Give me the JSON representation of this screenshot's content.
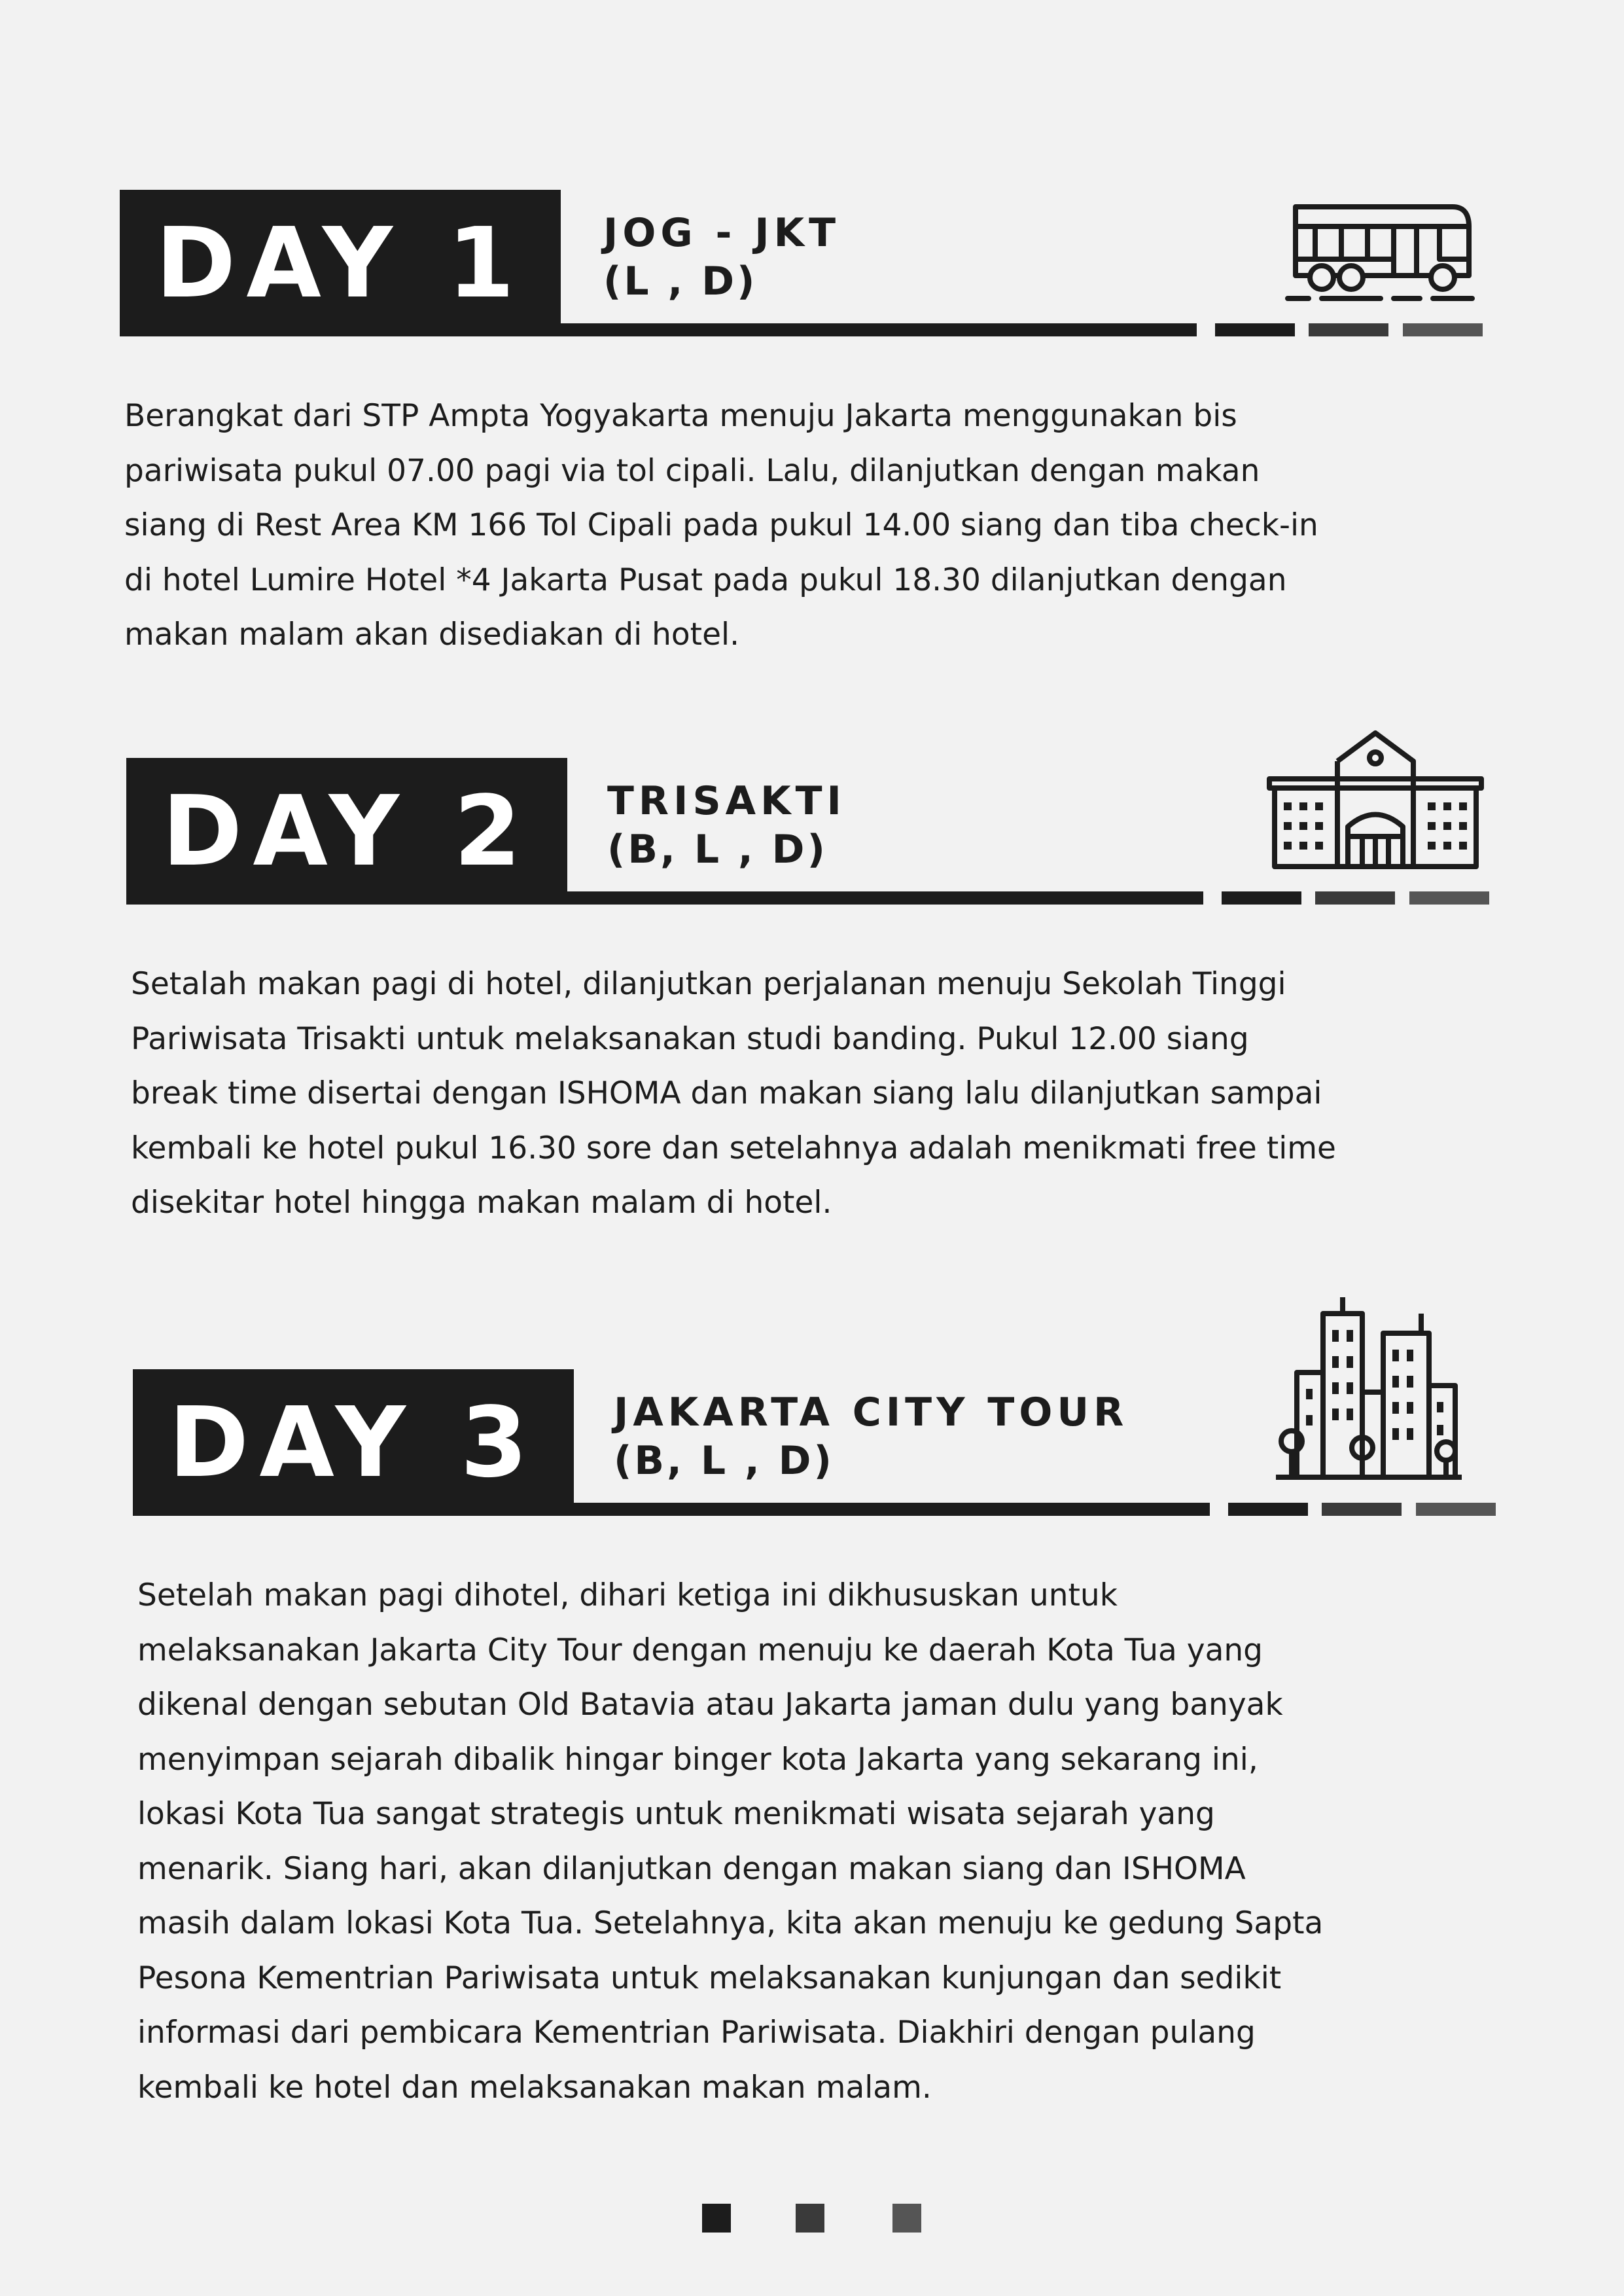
{
  "colors": {
    "ink": "#1c1c1c",
    "segment_dark": "#1c1c1c",
    "segment_mid": "#3a3a3a",
    "segment_light": "#555555",
    "background": "#f2f2f2"
  },
  "days": [
    {
      "label": "DAY 1",
      "title": "JOG - JKT",
      "meals": "(L , D)",
      "icon": "bus-icon",
      "body": [
        "Berangkat dari STP Ampta Yogyakarta menuju Jakarta menggunakan bis",
        "pariwisata pukul 07.00 pagi via tol cipali. Lalu, dilanjutkan dengan makan",
        "siang di Rest Area KM 166 Tol Cipali pada pukul 14.00 siang dan tiba check-in",
        "di hotel Lumire Hotel *4 Jakarta Pusat pada pukul 18.30 dilanjutkan dengan",
        "makan malam akan disediakan di hotel."
      ]
    },
    {
      "label": "DAY 2",
      "title": "TRISAKTI",
      "meals": "(B, L , D)",
      "icon": "school-building-icon",
      "body": [
        "Setalah makan pagi di hotel, dilanjutkan perjalanan menuju Sekolah Tinggi",
        "Pariwisata Trisakti untuk melaksanakan studi banding. Pukul 12.00 siang",
        "break time disertai dengan ISHOMA dan makan siang lalu dilanjutkan sampai",
        "kembali ke hotel pukul 16.30 sore dan setelahnya adalah menikmati free time",
        "disekitar hotel hingga makan malam di hotel."
      ]
    },
    {
      "label": "DAY 3",
      "title": "JAKARTA CITY TOUR",
      "meals": "(B, L , D)",
      "icon": "city-skyline-icon",
      "body": [
        "Setelah makan pagi dihotel, dihari ketiga ini dikhususkan untuk",
        "melaksanakan Jakarta City Tour dengan menuju ke daerah Kota Tua yang",
        "dikenal dengan sebutan Old Batavia atau Jakarta jaman dulu yang banyak",
        "menyimpan sejarah dibalik hingar binger kota Jakarta yang sekarang ini,",
        "lokasi Kota Tua sangat strategis untuk menikmati wisata sejarah yang",
        "menarik. Siang hari, akan dilanjutkan dengan makan siang dan ISHOMA",
        "masih dalam lokasi Kota Tua. Setelahnya, kita akan menuju ke gedung Sapta",
        "Pesona Kementrian Pariwisata untuk melaksanakan kunjungan dan sedikit",
        "informasi dari pembicara Kementrian Pariwisata. Diakhiri dengan pulang",
        "kembali ke hotel dan melaksanakan makan malam."
      ]
    }
  ],
  "footer": {
    "page_indicator": [
      "square-dark",
      "square-mid",
      "square-light"
    ]
  }
}
